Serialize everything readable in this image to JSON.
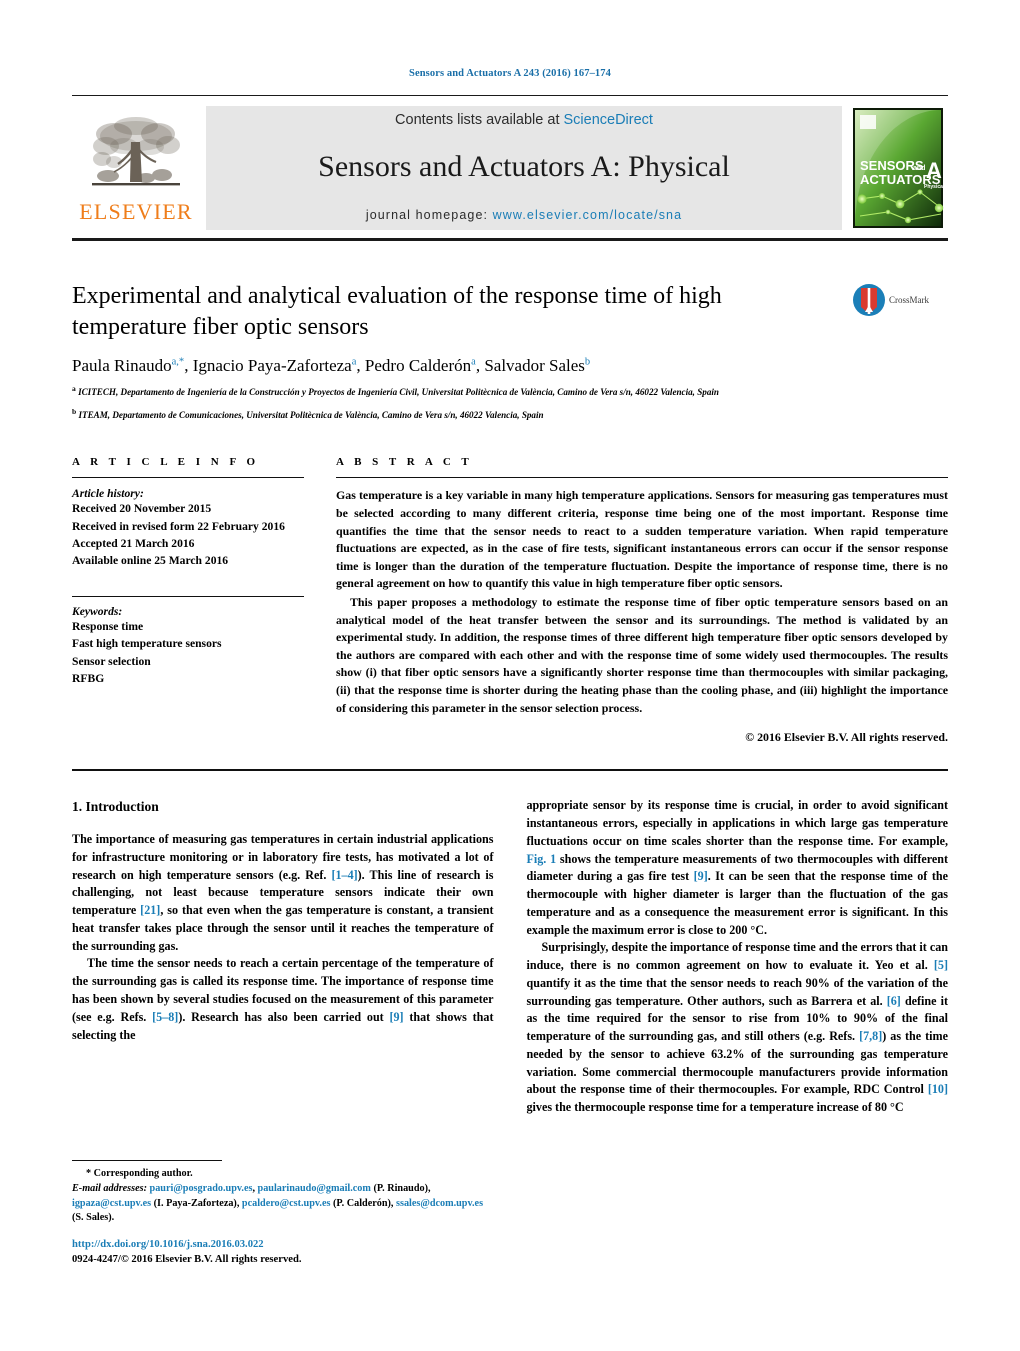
{
  "running_head": "Sensors and Actuators A 243 (2016) 167–174",
  "masthead": {
    "contents_prefix": "Contents lists available at ",
    "contents_link": "ScienceDirect",
    "journal_title": "Sensors and Actuators A: Physical",
    "homepage_prefix": "journal homepage: ",
    "homepage_url": "www.elsevier.com/locate/sna",
    "publisher_logo_word": "ELSEVIER",
    "cover_line1": "SENSORS",
    "cover_and": "and",
    "cover_line2": "ACTUATORS",
    "cover_letter": "A",
    "cover_sub": "Physical"
  },
  "article": {
    "title": "Experimental and analytical evaluation of the response time of high temperature fiber optic sensors",
    "crossmark_label": "CrossMark",
    "authors_html": "Paula Rinaudo<sup>a,*</sup>, Ignacio Paya-Zaforteza<sup>a</sup>, Pedro Calderón<sup>a</sup>, Salvador Sales<sup>b</sup>",
    "affiliation_a": "ICITECH, Departamento de Ingeniería de la Construcción y Proyectos de Ingeniería Civil, Universitat Politècnica de València, Camino de Vera s/n, 46022 Valencia, Spain",
    "affiliation_b": "ITEAM, Departamento de Comunicaciones, Universitat Politècnica de València, Camino de Vera s/n, 46022 Valencia, Spain"
  },
  "article_info": {
    "section_label": "A R T I C L E    I N F O",
    "history_heading": "Article history:",
    "history": [
      "Received 20 November 2015",
      "Received in revised form 22 February 2016",
      "Accepted 21 March 2016",
      "Available online 25 March 2016"
    ],
    "keywords_heading": "Keywords:",
    "keywords": [
      "Response time",
      "Fast high temperature sensors",
      "Sensor selection",
      "RFBG"
    ]
  },
  "abstract": {
    "section_label": "A B S T R A C T",
    "paragraph_1": "Gas temperature is a key variable in many high temperature applications. Sensors for measuring gas temperatures must be selected according to many different criteria, response time being one of the most important. Response time quantifies the time that the sensor needs to react to a sudden temperature variation. When rapid temperature fluctuations are expected, as in the case of fire tests, significant instantaneous errors can occur if the sensor response time is longer than the duration of the temperature fluctuation. Despite the importance of response time, there is no general agreement on how to quantify this value in high temperature fiber optic sensors.",
    "paragraph_2": "This paper proposes a methodology to estimate the response time of fiber optic temperature sensors based on an analytical model of the heat transfer between the sensor and its surroundings. The method is validated by an experimental study. In addition, the response times of three different high temperature fiber optic sensors developed by the authors are compared with each other and with the response time of some widely used thermocouples. The results show (i) that fiber optic sensors have a significantly shorter response time than thermocouples with similar packaging, (ii) that the response time is shorter during the heating phase than the cooling phase, and (iii) highlight the importance of considering this parameter in the sensor selection process.",
    "copyright": "© 2016 Elsevier B.V. All rights reserved."
  },
  "introduction": {
    "heading": "1.  Introduction",
    "left_p1_html": "The importance of measuring gas temperatures in certain industrial applications for infrastructure monitoring or in laboratory fire tests, has motivated a lot of research on high temperature sensors (e.g. Ref. <span class=\"ref\">[1–4]</span>). This line of research is challenging, not least because temperature sensors indicate their own temperature <span class=\"ref\">[21]</span>, so that even when the gas temperature is constant, a transient heat transfer takes place through the sensor until it reaches the temperature of the surrounding gas.",
    "left_p2_html": "The time the sensor needs to reach a certain percentage of the temperature of the surrounding gas is called its response time. The importance of response time has been shown by several studies focused on the measurement of this parameter (see e.g. Refs. <span class=\"ref\">[5–8]</span>). Research has also been carried out <span class=\"ref\">[9]</span> that shows that selecting the",
    "right_p1_html": "appropriate sensor by its response time is crucial, in order to avoid significant instantaneous errors, especially in applications in which large gas temperature fluctuations occur on time scales shorter than the response time. For example, <span class=\"ref\">Fig. 1</span> shows the temperature measurements of two thermocouples with different diameter during a gas fire test <span class=\"ref\">[9]</span>. It can be seen that the response time of the thermocouple with higher diameter is larger than the fluctuation of the gas temperature and as a consequence the measurement error is significant. In this example the maximum error is close to 200 °C.",
    "right_p2_html": "Surprisingly, despite the importance of response time and the errors that it can induce, there is no common agreement on how to evaluate it. Yeo et al. <span class=\"ref\">[5]</span> quantify it as the time that the sensor needs to reach 90% of the variation of the surrounding gas temperature. Other authors, such as Barrera et al. <span class=\"ref\">[6]</span> define it as the time required for the sensor to rise from 10% to 90% of the final temperature of the surrounding gas, and still others (e.g. Refs. <span class=\"ref\">[7,8]</span>) as the time needed by the sensor to achieve 63.2% of the surrounding gas temperature variation. Some commercial thermocouple manufacturers provide information about the response time of their thermocouples. For example, RDC Control <span class=\"ref\">[10]</span> gives the thermocouple response time for a temperature increase of 80 °C"
  },
  "footnotes": {
    "corresponding": "* Corresponding author.",
    "emails_html": "<span class=\"lbl\">E-mail addresses:</span> <span class=\"link\">pauri@posgrado.upv.es</span>, <span class=\"link\">paularinaudo@gmail.com</span> (P. Rinaudo), <span class=\"link\">igpaza@cst.upv.es</span> (I. Paya-Zaforteza), <span class=\"link\">pcaldero@cst.upv.es</span> (P. Calderón), <span class=\"link\">ssales@dcom.upv.es</span> (S. Sales).",
    "doi": "http://dx.doi.org/10.1016/j.sna.2016.03.022",
    "issn_line": "0924-4247/© 2016 Elsevier B.V. All rights reserved."
  }
}
